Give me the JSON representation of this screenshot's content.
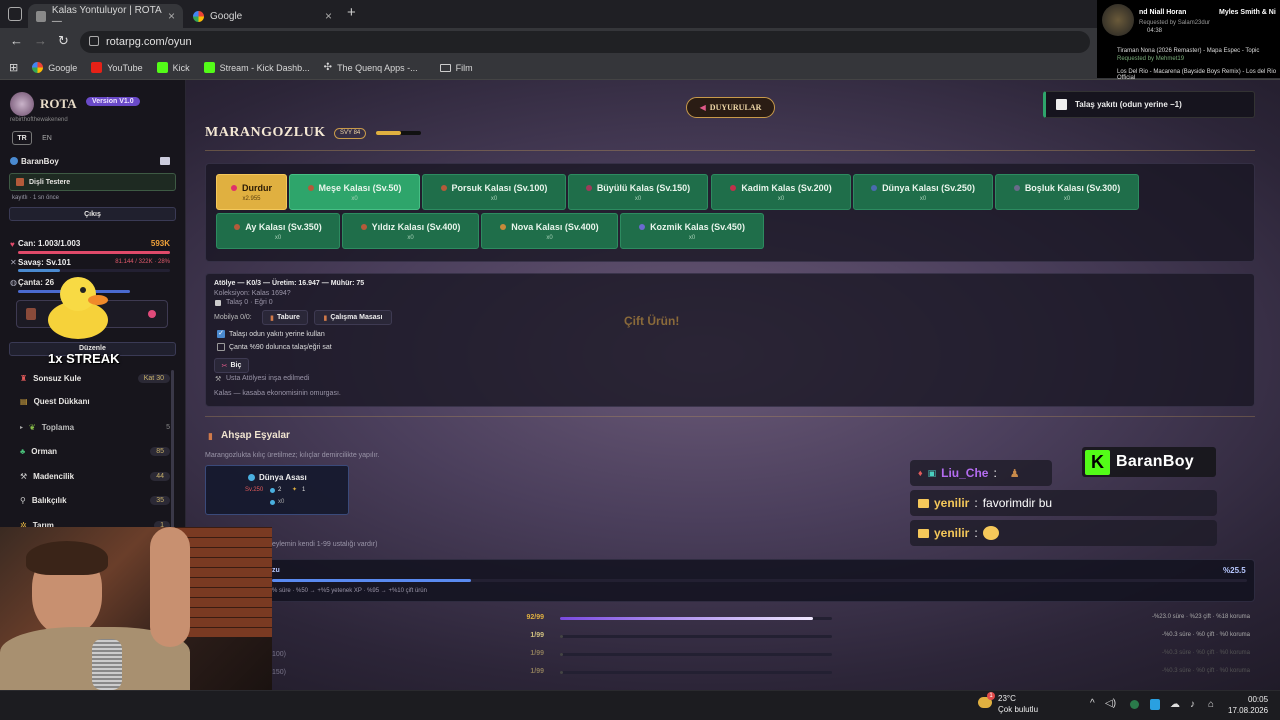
{
  "browser": {
    "tabs": [
      {
        "title": "Kalas Yontuluyor | ROTA —",
        "active": true
      },
      {
        "title": "Google",
        "active": false
      }
    ],
    "url": "rotarpg.com/oyun",
    "bookmarks": [
      "Google",
      "YouTube",
      "Kick",
      "Stream - Kick Dashb...",
      "The Quenq Apps -...",
      "Film"
    ]
  },
  "now_playing": {
    "track": "nd Niall Horan",
    "track2": "Myles Smith & Ni",
    "requested": "Requested by Salam23dur",
    "time": "04:38",
    "queue": [
      {
        "title": "Tiraman Nona (2026 Remaster) - Mapa Espec - Topic",
        "requested": "Requested by Mehmet19"
      },
      {
        "title": "Los Del Rio - Macarena (Bayside Boys Remix) - Los del Rio Official",
        "requested": ""
      }
    ]
  },
  "sidebar": {
    "logo": "ROTA",
    "version": "Version V1.0",
    "tagline": "rebirthofthewakenend",
    "langs": [
      "TR",
      "EN"
    ],
    "username": "BaranBoy",
    "item": "Dişli Testere",
    "status": "kayıtlı · 1 sn önce",
    "exit": "Çıkış",
    "can_label": "Can: 1.003/1.003",
    "can_value": "593K",
    "savas_label": "Savaş: Sv.101",
    "savas_value": "81.144 / 322K · 28%",
    "canta_label": "Çanta: 26",
    "edit": "Düzenle",
    "streak": "1x STREAK",
    "nav": [
      {
        "label": "Sonsuz Kule",
        "badge": "Kat 30"
      },
      {
        "label": "Quest Dükkanı",
        "badge": ""
      },
      {
        "label": "Toplama",
        "badge": "5"
      },
      {
        "label": "Orman",
        "badge": "85"
      },
      {
        "label": "Madencilik",
        "badge": "44"
      },
      {
        "label": "Balıkçılık",
        "badge": "35"
      },
      {
        "label": "Tarım",
        "badge": "1"
      }
    ]
  },
  "header": {
    "announcements": "Duyurular",
    "title": "Marangozluk",
    "level": "Svy 84",
    "level_progress": 0.55,
    "toast": "Talaş yakıtı (odun yerine −1)"
  },
  "products": [
    {
      "label": "Durdur",
      "sub": "x2.955",
      "kind": "stop"
    },
    {
      "label": "Meşe Kalası (Sv.50)",
      "sub": "x0",
      "kind": "highlight"
    },
    {
      "label": "Porsuk Kalası (Sv.100)",
      "sub": "x0",
      "kind": "normal"
    },
    {
      "label": "Büyülü Kalas (Sv.150)",
      "sub": "x0",
      "kind": "normal"
    },
    {
      "label": "Kadim Kalas (Sv.200)",
      "sub": "x0",
      "kind": "normal"
    },
    {
      "label": "Dünya Kalası (Sv.250)",
      "sub": "x0",
      "kind": "normal"
    },
    {
      "label": "Boşluk Kalası (Sv.300)",
      "sub": "x0",
      "kind": "normal"
    },
    {
      "label": "Ay Kalası (Sv.350)",
      "sub": "x0",
      "kind": "normal"
    },
    {
      "label": "Yıldız Kalası (Sv.400)",
      "sub": "x0",
      "kind": "normal"
    },
    {
      "label": "Nova Kalası (Sv.400)",
      "sub": "x0",
      "kind": "normal"
    },
    {
      "label": "Kozmik Kalas (Sv.450)",
      "sub": "x0",
      "kind": "normal"
    }
  ],
  "workshop": {
    "line1": "Atölye — K0/3 — Üretim: 16.947 — Mühür: 75",
    "line2": "Koleksiyon: Kalas 1694?",
    "line3": "Talaş 0 · Eğri 0",
    "mobilya": "Mobilya 0/0:",
    "btn_tabure": "Tabure",
    "btn_masa": "Çalışma Masası",
    "chk1": "Talaşı odun yakıtı yerine kullan",
    "chk2": "Çanta %90 dolunca talaş/eğri sat",
    "btn_bic": "Biç",
    "note1": "Usta Atölyesi inşa edilmedi",
    "note2": "Kalas — kasaba ekonomisinin omurgası.",
    "double": "Çift Ürün!"
  },
  "wooden": {
    "title": "Ahşap Eşyalar",
    "desc": "Marangozlukta kılıç üretilmez; kılıçlar demircilikte yapılır.",
    "card_title": "Dünya Asası",
    "card_lvl": "Sv.250",
    "card_a": "2",
    "card_b": "1",
    "card_count": "x0",
    "skill_note": "eylemin kendi 1-99 ustalığı vardır)"
  },
  "mastery": {
    "label": "zu",
    "percent": "%25.5",
    "progress": 0.255,
    "desc": "% süre · %50 → +%5 yetenek XP · %95 → +%10 çift ürün",
    "rows": [
      {
        "label": "",
        "value": "92/99",
        "progress": 0.93,
        "bonus": "-%23.0 süre · %23 çift · %18 koruma",
        "color": "#9b6cf0"
      },
      {
        "label": "",
        "value": "1/99",
        "progress": 0.01,
        "bonus": "-%0.3 süre · %0 çift · %0 koruma",
        "color": "#444"
      },
      {
        "label": "100)",
        "value": "1/99",
        "progress": 0.01,
        "bonus": "-%0.3 süre · %0 çift · %0 koruma",
        "color": "#444"
      },
      {
        "label": "150)",
        "value": "1/99",
        "progress": 0.01,
        "bonus": "-%0.3 süre · %0 çift · %0 koruma",
        "color": "#444"
      }
    ]
  },
  "chat": {
    "streamer": "BaranBoy",
    "messages": [
      {
        "user": "Liu_Che",
        "text": "",
        "color": "#b46cf0"
      },
      {
        "user": "yenilir",
        "text": "favorimdir bu",
        "color": "#f5c85a"
      },
      {
        "user": "yenilir",
        "text": "",
        "color": "#f5c85a"
      }
    ]
  },
  "taskbar": {
    "weather_temp": "23°C",
    "weather_desc": "Çok bulutlu",
    "time": "00:05",
    "date": "17.08.2026",
    "weather_badge": "1"
  },
  "colors": {
    "accent_gold": "#e0b040",
    "green_btn": "#1f6e4a",
    "purple": "#9b6cf0",
    "kick_green": "#53fc18"
  }
}
